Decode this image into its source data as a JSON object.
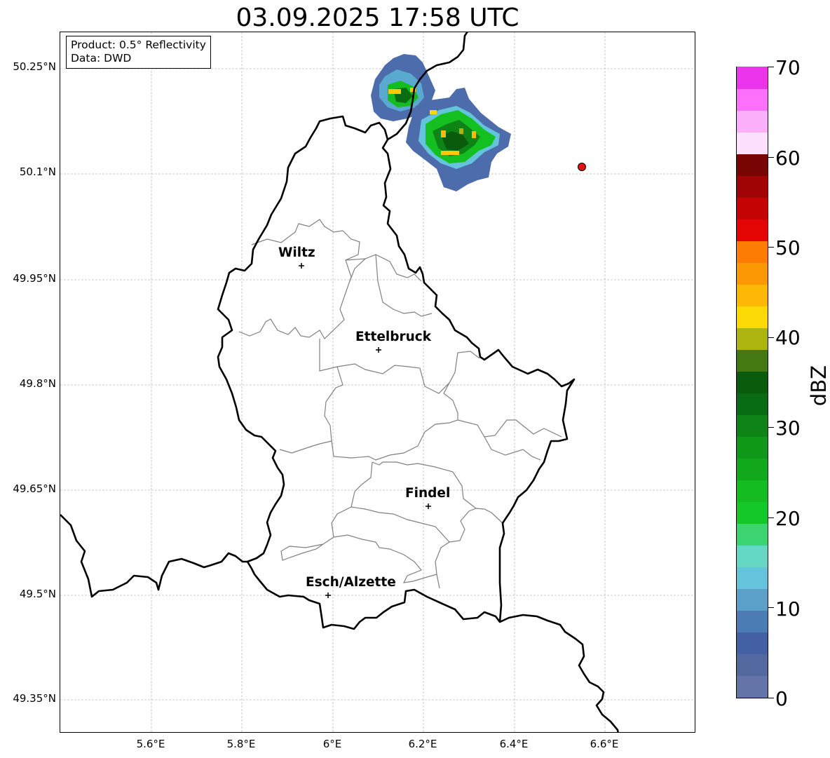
{
  "title": "03.09.2025 17:58 UTC",
  "info": {
    "product": "Product: 0.5° Reflectivity",
    "data_source": "Data: DWD"
  },
  "axes": {
    "lat_ticks": [
      "50.25°N",
      "50.1°N",
      "49.95°N",
      "49.8°N",
      "49.65°N",
      "49.5°N",
      "49.35°N"
    ],
    "lon_ticks": [
      "5.6°E",
      "5.8°E",
      "6°E",
      "6.2°E",
      "6.4°E",
      "6.6°E"
    ]
  },
  "cities": [
    {
      "name": "Wiltz"
    },
    {
      "name": "Ettelbruck"
    },
    {
      "name": "Findel"
    },
    {
      "name": "Esch/Alzette"
    }
  ],
  "colorbar": {
    "unit": "dBZ",
    "tick_labels": [
      "70",
      "60",
      "50",
      "40",
      "30",
      "20",
      "10",
      "0"
    ],
    "range": [
      0,
      70
    ],
    "colors": [
      "#6474a8",
      "#5468a0",
      "#4460a4",
      "#4c7cb4",
      "#5aa0c8",
      "#64c4dc",
      "#64d8c4",
      "#3cd470",
      "#14c828",
      "#14bc20",
      "#12a81c",
      "#109818",
      "#0e8416",
      "#0a6c12",
      "#0a5c0c",
      "#447812",
      "#acb410",
      "#fcd804",
      "#fcb804",
      "#fc9804",
      "#fc7c04",
      "#e40404",
      "#c40404",
      "#a00404",
      "#780404",
      "#fce0fc",
      "#fcb0fc",
      "#fc70fc",
      "#ec34ec"
    ]
  },
  "marker": {
    "color": "#e41414"
  }
}
